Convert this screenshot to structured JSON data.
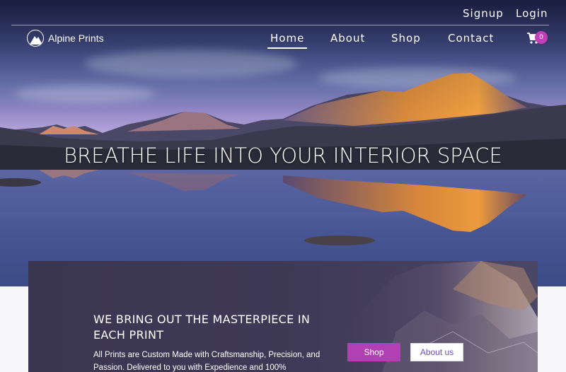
{
  "topbar": {
    "signup_label": "Signup",
    "login_label": "Login"
  },
  "brand": {
    "name": "Alpine Prints",
    "logo_icon": "mountain-logo-icon"
  },
  "nav": {
    "items": [
      {
        "label": "Home",
        "active": true
      },
      {
        "label": "About",
        "active": false
      },
      {
        "label": "Shop",
        "active": false
      },
      {
        "label": "Contact",
        "active": false
      }
    ],
    "cart_icon": "cart-icon",
    "cart_count": "0"
  },
  "hero": {
    "headline": "BREATHE LIFE INTO YOUR INTERIOR SPACE"
  },
  "feature": {
    "title": "WE BRING OUT THE MASTERPIECE IN EACH PRINT",
    "body": "All Prints are Custom Made with Craftsmanship, Precision, and Passion. Delivered to you with Expedience and 100%",
    "shop_label": "Shop",
    "about_label": "About us"
  },
  "colors": {
    "accent": "#b23fb3",
    "badge": "#c23fb8",
    "card_bg": "#3f3a57"
  }
}
